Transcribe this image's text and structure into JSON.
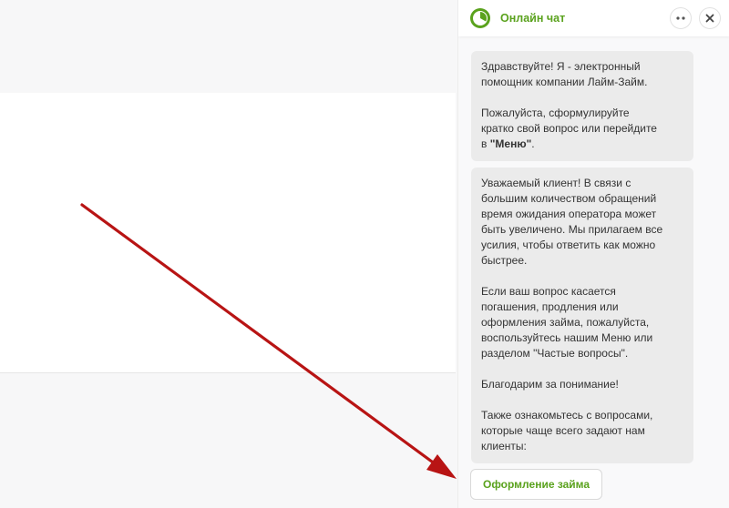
{
  "colors": {
    "accent": "#5aa21d",
    "bubble": "#ebebeb",
    "annotation_arrow": "#b81414"
  },
  "header": {
    "title": "Онлайн чат",
    "logo_icon": "lime-clock-logo-icon",
    "menu_icon": "more-dots-icon",
    "close_icon": "close-icon"
  },
  "messages": [
    {
      "p1": "Здравствуйте! Я - электронный\nпомощник компании Лайм-Займ.",
      "p2_prefix": "Пожалуйста, сформулируйте\nкратко свой вопрос или перейдите\nв ",
      "p2_bold": "\"Меню\"",
      "p2_suffix": "."
    },
    {
      "p1": "Уважаемый клиент! В связи с\nбольшим количеством обращений\nвремя ожидания оператора может\nбыть увеличено. Мы прилагаем все\nусилия, чтобы ответить как можно\nбыстрее.",
      "p2": "Если ваш вопрос касается\nпогашения, продления или\nоформления займа, пожалуйста,\nвоспользуйтесь нашим Меню или\nразделом \"Частые вопросы\".",
      "p3": "Благодарим за понимание!",
      "p4": "Также ознакомьтесь с вопросами,\nкоторые чаще всего задают нам\nклиенты:"
    }
  ],
  "quick_replies": [
    "Оформление займа"
  ]
}
